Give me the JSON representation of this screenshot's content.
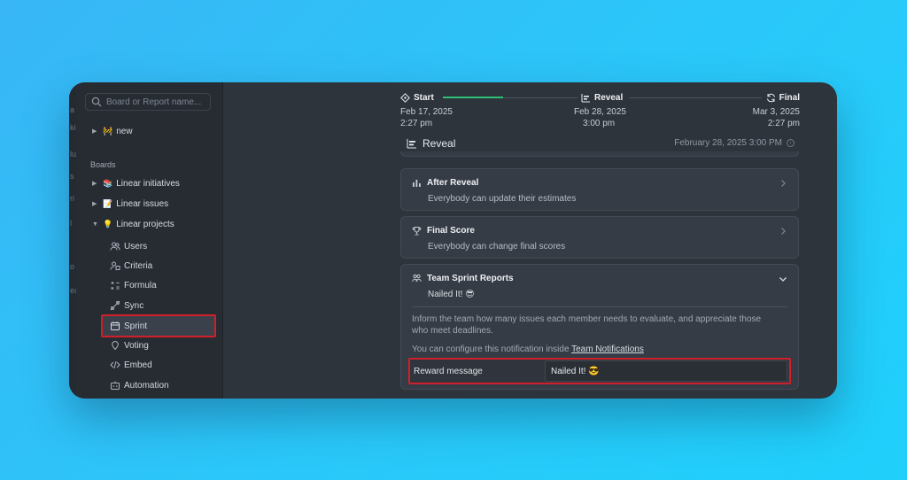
{
  "edge_letters": [
    "a",
    "ki",
    "lu",
    "s",
    "ri",
    "l",
    "o",
    "ea"
  ],
  "sidebar": {
    "search_placeholder": "Board or Report name...",
    "top_item": {
      "emoji": "🚧",
      "label": "new"
    },
    "boards_heading": "Boards",
    "boards": [
      {
        "emoji": "📚",
        "label": "Linear initiatives",
        "expanded": false
      },
      {
        "emoji": "📝",
        "label": "Linear issues",
        "expanded": false
      },
      {
        "emoji": "💡",
        "label": "Linear projects",
        "expanded": true
      }
    ],
    "sub_items": [
      {
        "icon": "users-icon",
        "label": "Users"
      },
      {
        "icon": "criteria-icon",
        "label": "Criteria"
      },
      {
        "icon": "formula-icon",
        "label": "Formula"
      },
      {
        "icon": "sync-icon",
        "label": "Sync"
      },
      {
        "icon": "calendar-icon",
        "label": "Sprint",
        "active": true
      },
      {
        "icon": "voting-icon",
        "label": "Voting"
      },
      {
        "icon": "code-icon",
        "label": "Embed"
      },
      {
        "icon": "robot-icon",
        "label": "Automation"
      }
    ]
  },
  "timeline": {
    "progress": 0.45,
    "steps": [
      {
        "label": "Start",
        "date": "Feb 17, 2025",
        "time": "2:27 pm",
        "icon": "start-icon"
      },
      {
        "label": "Reveal",
        "date": "Feb 28, 2025",
        "time": "3:00 pm",
        "icon": "reveal-icon"
      },
      {
        "label": "Final",
        "date": "Mar 3, 2025",
        "time": "2:27 pm",
        "icon": "final-icon"
      }
    ],
    "accent": "#2fbf76"
  },
  "section": {
    "title": "Reveal",
    "date": "February 28, 2025 3:00 PM"
  },
  "cards": [
    {
      "title": "After Reveal",
      "desc": "Everybody can update their estimates",
      "icon": "chart-icon"
    },
    {
      "title": "Final Score",
      "desc": "Everybody can change final scores",
      "icon": "trophy-icon"
    }
  ],
  "team_card": {
    "title": "Team Sprint Reports",
    "subtitle": "Nailed It! 😎",
    "info_line1": "Inform the team how many issues each member needs to evaluate, and appreciate those",
    "info_line2": "who meet deadlines.",
    "config_text": "You can configure this notification inside ",
    "config_link": "Team Notifications",
    "reward_label": "Reward message",
    "reward_value": "Nailed It! 😎"
  },
  "colors": {
    "highlight": "#d11f2a",
    "panel": "#2e343c",
    "sidebar": "#272c33"
  }
}
